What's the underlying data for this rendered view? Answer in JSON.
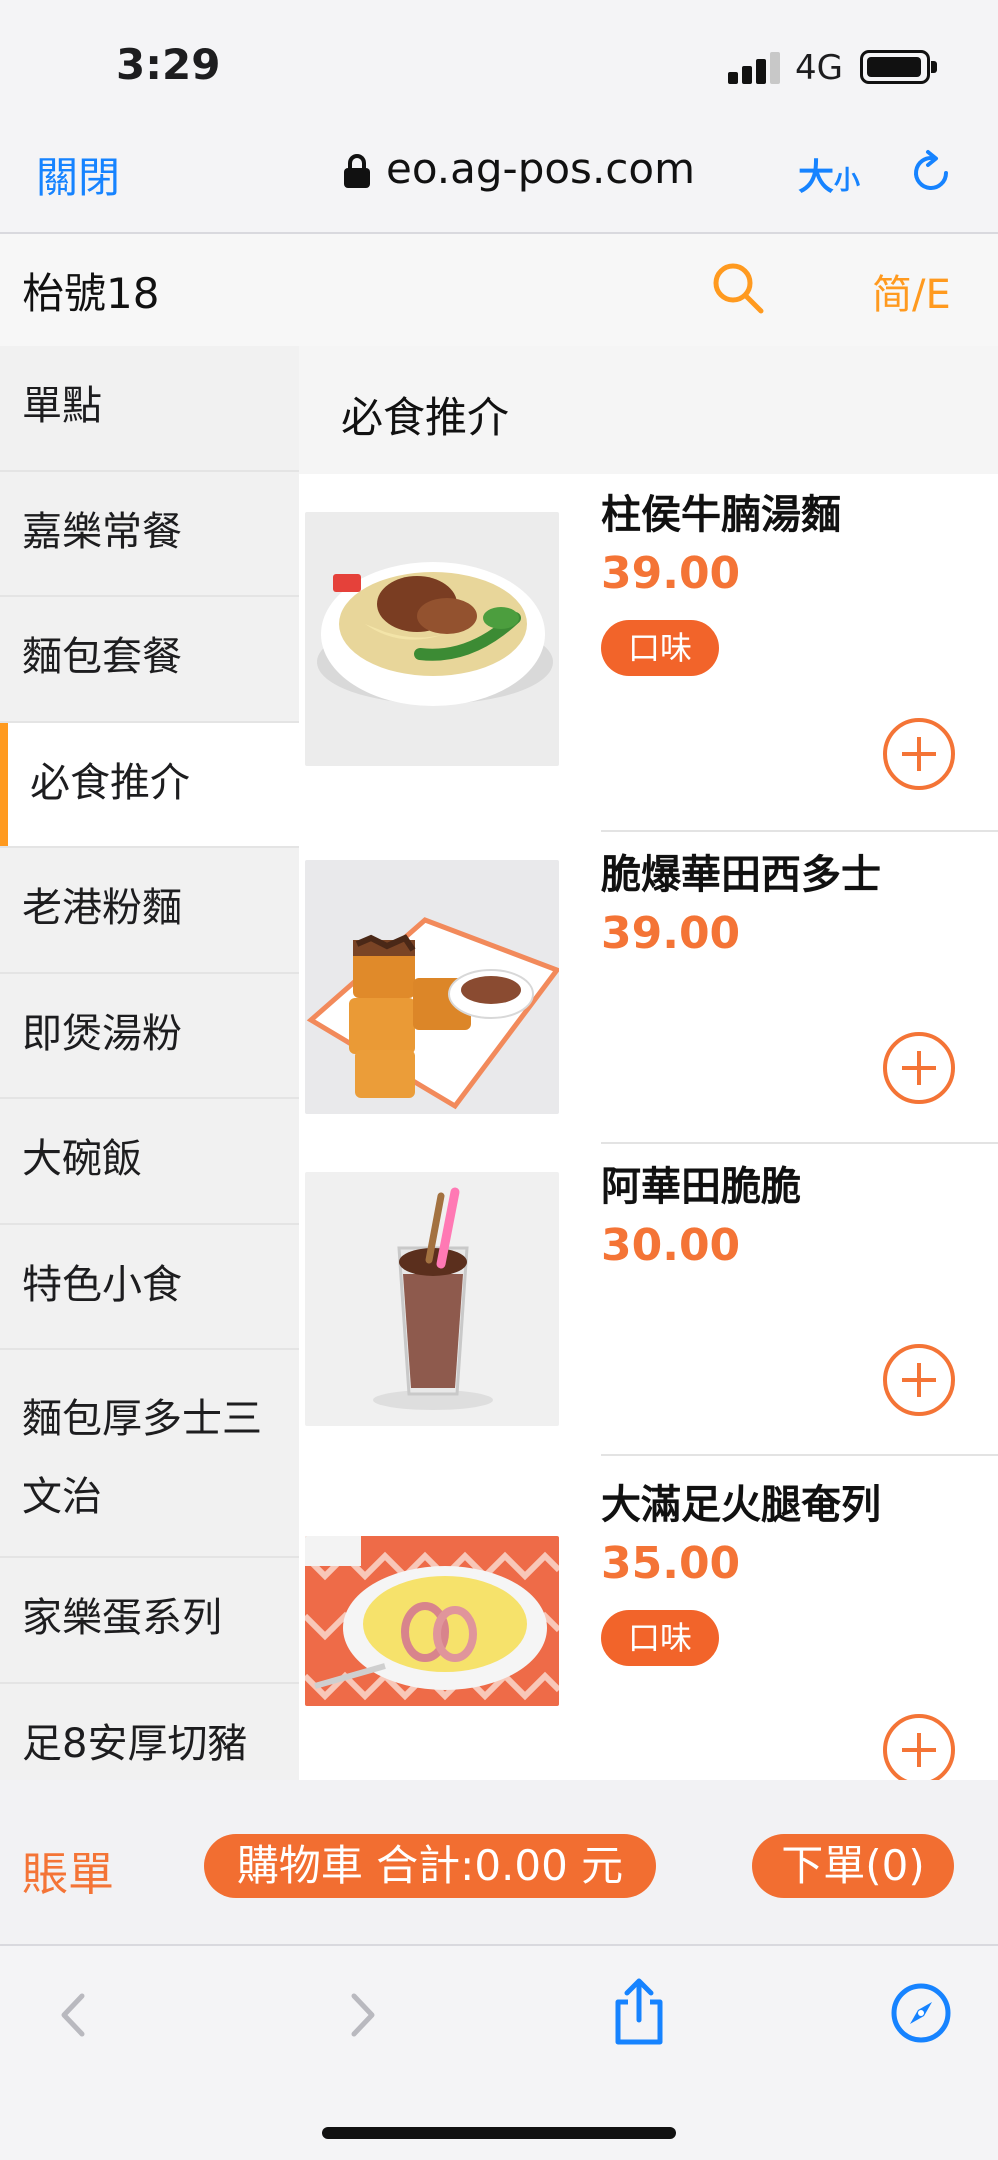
{
  "status": {
    "time": "3:29",
    "network": "4G"
  },
  "browser": {
    "close_label": "關閉",
    "url": "eo.ag-pos.com",
    "text_size_big": "大",
    "text_size_small": "小"
  },
  "store": {
    "name": "枱號18",
    "lang_toggle": "简/E"
  },
  "categories": [
    {
      "label": "單點"
    },
    {
      "label": "嘉樂常餐"
    },
    {
      "label": "麵包套餐"
    },
    {
      "label": "必食推介"
    },
    {
      "label": "老港粉麵"
    },
    {
      "label": "即煲湯粉"
    },
    {
      "label": "大碗飯"
    },
    {
      "label": "特色小食"
    },
    {
      "label": "麵包厚多士三文治"
    },
    {
      "label": "家樂蛋系列"
    },
    {
      "label": "足8安厚切豬"
    }
  ],
  "selected_category": "必食推介",
  "section_title": "必食推介",
  "products": [
    {
      "name": "柱侯牛腩湯麵",
      "price": "39.00",
      "badge": "口味"
    },
    {
      "name": "脆爆華田西多士",
      "price": "39.00"
    },
    {
      "name": "阿華田脆脆",
      "price": "30.00"
    },
    {
      "name": "大滿足火腿奄列",
      "price": "35.00",
      "badge": "口味"
    }
  ],
  "actions": {
    "bill": "賬單",
    "cart": "購物車 合計:0.00 元",
    "order": "下單(0)"
  },
  "colors": {
    "accent": "#f47436",
    "browser_blue": "#1683ff",
    "category_indicator": "#ff9a1f"
  }
}
